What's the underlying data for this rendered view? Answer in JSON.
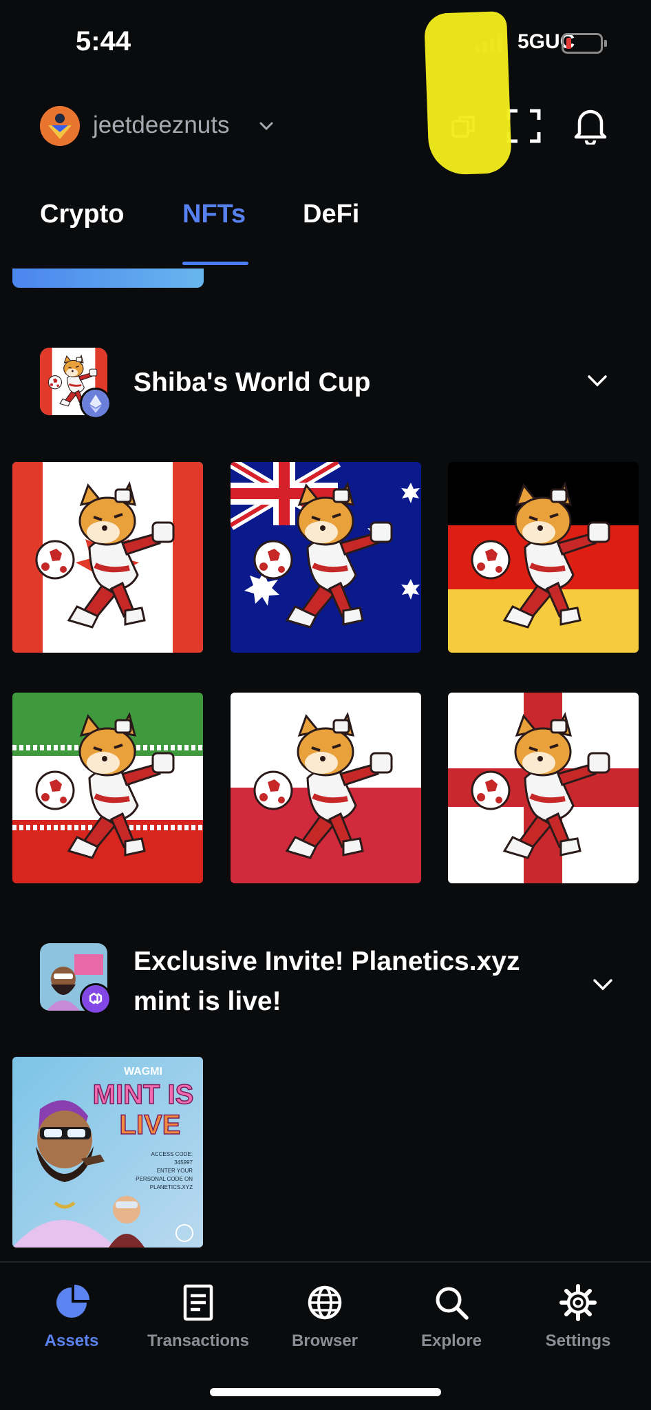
{
  "status_bar": {
    "time": "5:44",
    "network": "5GUC",
    "battery_color": "#e53935"
  },
  "header": {
    "account_name": "jeetdeeznuts",
    "icons": [
      "chevron-down-icon",
      "copy-icon",
      "scan-icon",
      "bell-icon"
    ]
  },
  "tabs": [
    {
      "label": "Crypto",
      "active": false
    },
    {
      "label": "NFTs",
      "active": true
    },
    {
      "label": "DeFi",
      "active": false
    }
  ],
  "collections": [
    {
      "name": "Shiba's World Cup",
      "chain": "ethereum",
      "items": [
        "canada",
        "australia",
        "germany",
        "iran",
        "poland",
        "england"
      ]
    },
    {
      "name_line1": "Exclusive Invite! Planetics.xyz",
      "name_line2": "mint is live!",
      "chain": "polygon",
      "items": [
        "wagmi-mint-is-live"
      ],
      "tile_texts": {
        "top": "WAGMI",
        "line1": "MINT IS",
        "line2": "LIVE",
        "access": "ACCESS CODE:",
        "code": "345997",
        "enter": "ENTER YOUR",
        "personal": "PERSONAL CODE ON",
        "site": "PLANETICS.XYZ"
      }
    }
  ],
  "bottom_nav": [
    {
      "label": "Assets",
      "icon": "pie-chart-icon",
      "active": true
    },
    {
      "label": "Transactions",
      "icon": "document-icon",
      "active": false
    },
    {
      "label": "Browser",
      "icon": "globe-icon",
      "active": false
    },
    {
      "label": "Explore",
      "icon": "search-icon",
      "active": false
    },
    {
      "label": "Settings",
      "icon": "gear-icon",
      "active": false
    }
  ],
  "colors": {
    "accent": "#5881f0",
    "background": "#0a0b0d",
    "muted": "#8c8f96"
  }
}
